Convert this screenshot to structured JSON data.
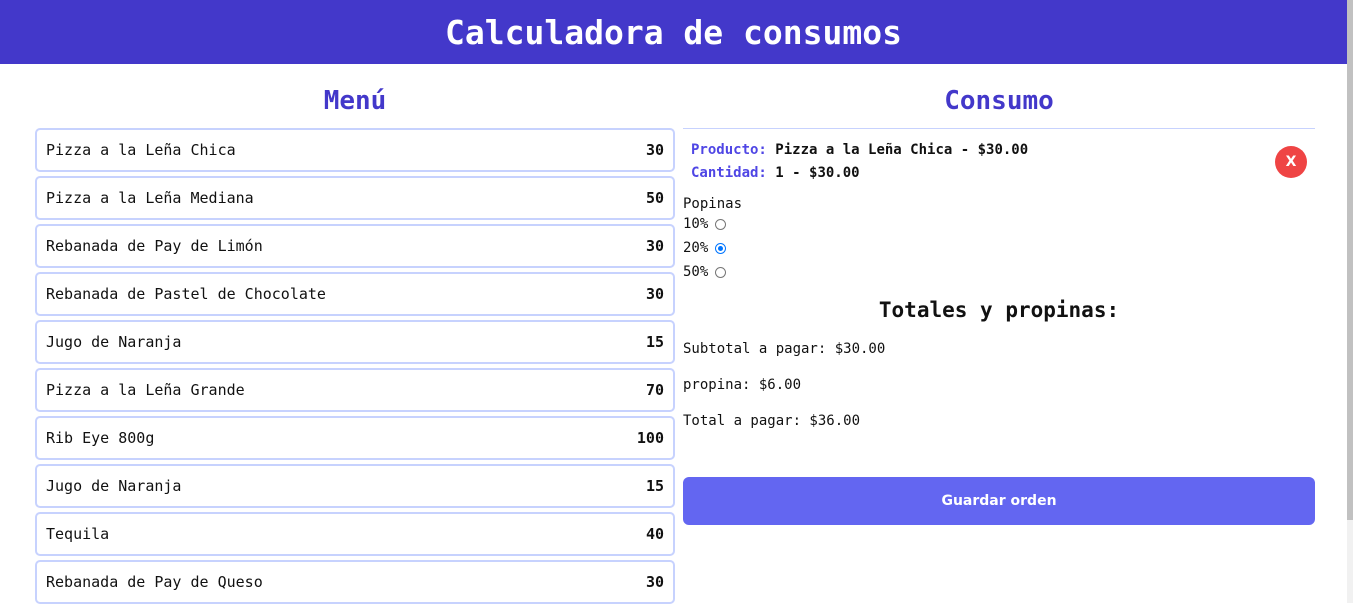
{
  "header": {
    "title": "Calculadora de consumos"
  },
  "menu": {
    "title": "Menú",
    "items": [
      {
        "name": "Pizza a la Leña Chica",
        "price": "30"
      },
      {
        "name": "Pizza a la Leña Mediana",
        "price": "50"
      },
      {
        "name": "Rebanada de Pay de Limón",
        "price": "30"
      },
      {
        "name": "Rebanada de Pastel de Chocolate",
        "price": "30"
      },
      {
        "name": "Jugo de Naranja",
        "price": "15"
      },
      {
        "name": "Pizza a la Leña Grande",
        "price": "70"
      },
      {
        "name": "Rib Eye 800g",
        "price": "100"
      },
      {
        "name": "Jugo de Naranja",
        "price": "15"
      },
      {
        "name": "Tequila",
        "price": "40"
      },
      {
        "name": "Rebanada de Pay de Queso",
        "price": "30"
      }
    ]
  },
  "consumo": {
    "title": "Consumo",
    "order": {
      "product_label": "Producto:",
      "product_value": "Pizza a la Leña Chica - $30.00",
      "quantity_label": "Cantidad:",
      "quantity_value": "1 - $30.00",
      "remove_label": "X"
    },
    "tips": {
      "title": "Popinas",
      "options": [
        {
          "label": "10%",
          "checked": false
        },
        {
          "label": "20%",
          "checked": true
        },
        {
          "label": "50%",
          "checked": false
        }
      ]
    },
    "totals": {
      "title": "Totales y propinas:",
      "subtotal": "Subtotal a pagar: $30.00",
      "tip": "propina: $6.00",
      "total": "Total a pagar: $36.00"
    },
    "save_label": "Guardar orden"
  },
  "colors": {
    "header_bg": "#4338ca",
    "accent": "#4f46e5",
    "button_bg": "#6366f1",
    "remove_bg": "#ef4444",
    "item_border": "#c7d2fe"
  }
}
